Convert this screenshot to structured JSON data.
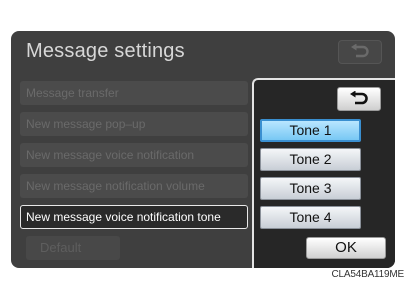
{
  "screen": {
    "title": "Message settings"
  },
  "menu": {
    "items": [
      {
        "label": "Message transfer"
      },
      {
        "label": "New message pop–up"
      },
      {
        "label": "New message voice notification"
      },
      {
        "label": "New message notification volume"
      },
      {
        "label": "New message voice notification tone"
      }
    ],
    "default_label": "Default"
  },
  "popup": {
    "back_icon": "return-arrow-icon",
    "tones": [
      {
        "label": "Tone 1",
        "selected": true
      },
      {
        "label": "Tone 2",
        "selected": false
      },
      {
        "label": "Tone 3",
        "selected": false
      },
      {
        "label": "Tone 4",
        "selected": false
      }
    ],
    "ok_label": "OK"
  },
  "caption": "CLA54BA119ME",
  "colors": {
    "screen_bg": "#3f3f3f",
    "selected_tone": "#8fd3f7",
    "active_row_border": "#e8e8e8"
  }
}
